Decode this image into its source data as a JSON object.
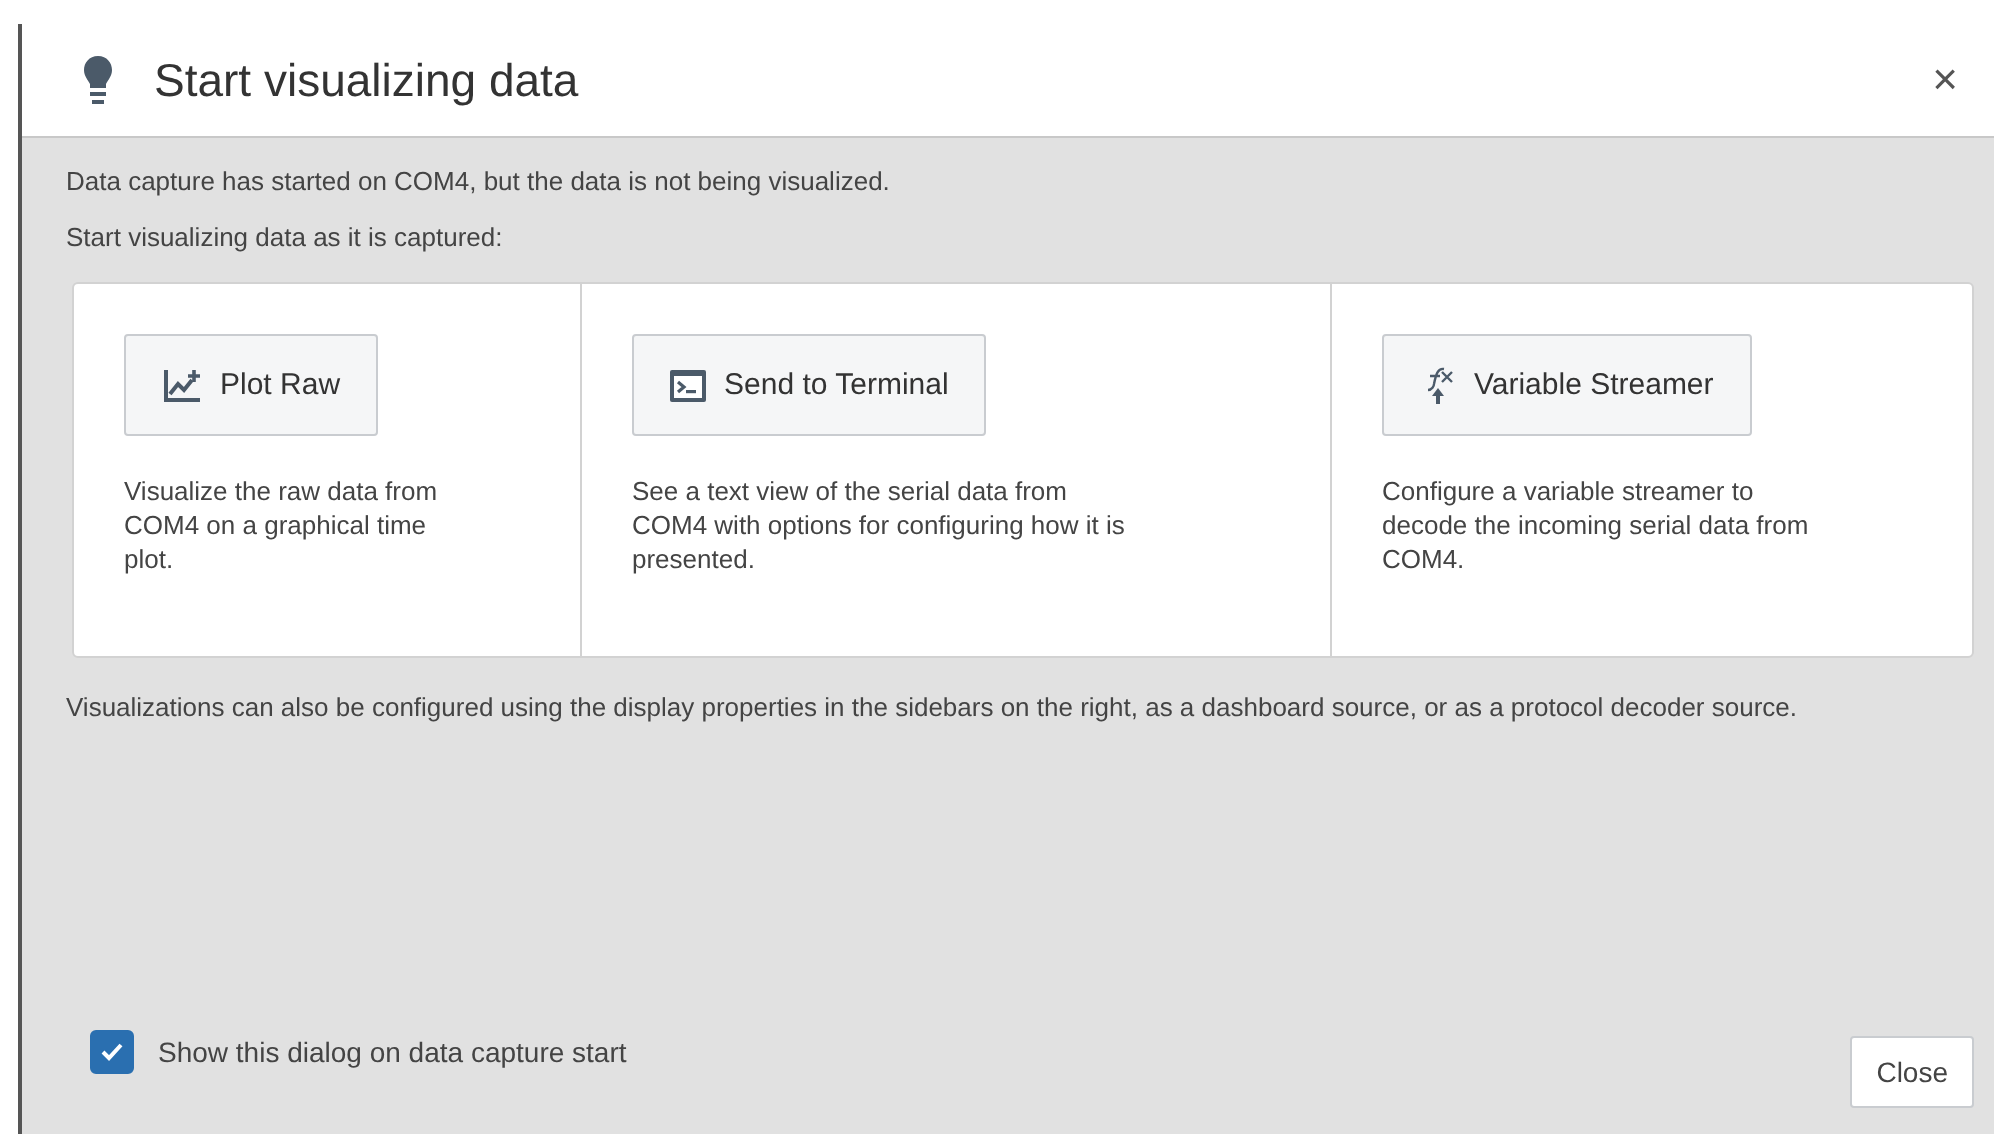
{
  "dialog": {
    "title": "Start visualizing data",
    "close_icon": "×"
  },
  "intro": [
    "Data capture has started on COM4, but the data is not being visualized.",
    "Start visualizing data as it is captured:"
  ],
  "options": [
    {
      "kind": "plot",
      "button": "Plot Raw",
      "description": "Visualize the raw data from COM4 on a graphical time plot."
    },
    {
      "kind": "terminal",
      "button": "Send to Terminal",
      "description": "See a text view of the serial data from COM4 with options for configuring how it is presented."
    },
    {
      "kind": "streamer",
      "button": "Variable Streamer",
      "description": "Configure a variable streamer to decode the incoming serial data from COM4."
    }
  ],
  "note": "Visualizations can also be configured using the display properties in the sidebars on the right, as a dashboard source, or as a protocol decoder source.",
  "footer": {
    "checkbox": {
      "label": "Show this dialog on data capture start",
      "checked": true
    },
    "close_button": "Close"
  }
}
